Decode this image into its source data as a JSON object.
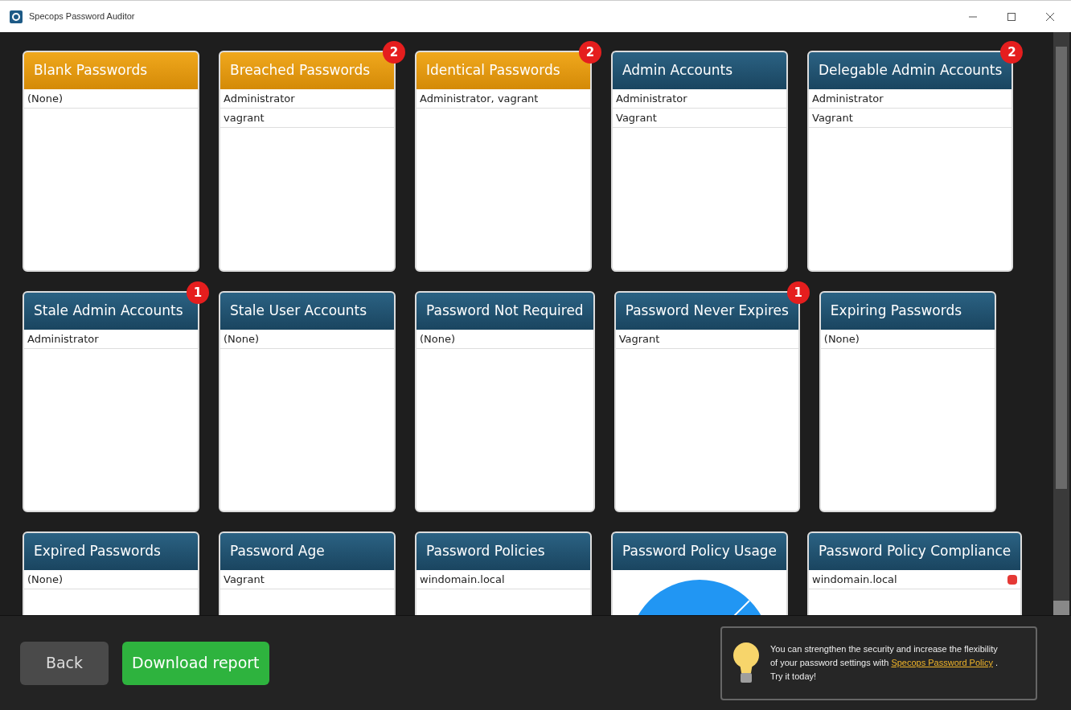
{
  "window": {
    "title": "Specops Password Auditor"
  },
  "rows": [
    [
      {
        "title": "Blank Passwords",
        "kind": "warning",
        "items": [
          {
            "text": "(None)"
          }
        ]
      },
      {
        "title": "Breached Passwords",
        "kind": "warning",
        "badge": "2",
        "items": [
          {
            "text": "Administrator"
          },
          {
            "text": "vagrant"
          }
        ]
      },
      {
        "title": "Identical Passwords",
        "kind": "warning",
        "badge": "2",
        "items": [
          {
            "text": "Administrator, vagrant"
          }
        ]
      },
      {
        "title": "Admin Accounts",
        "kind": "info",
        "items": [
          {
            "text": "Administrator"
          },
          {
            "text": "Vagrant"
          }
        ]
      },
      {
        "title": "Delegable Admin Accounts",
        "kind": "info",
        "badge": "2",
        "items": [
          {
            "text": "Administrator"
          },
          {
            "text": "Vagrant"
          }
        ]
      }
    ],
    [
      {
        "title": "Stale Admin Accounts",
        "kind": "info",
        "badge": "1",
        "items": [
          {
            "text": "Administrator"
          }
        ]
      },
      {
        "title": "Stale User Accounts",
        "kind": "info",
        "items": [
          {
            "text": "(None)"
          }
        ]
      },
      {
        "title": "Password Not Required",
        "kind": "info",
        "items": [
          {
            "text": "(None)"
          }
        ]
      },
      {
        "title": "Password Never Expires",
        "kind": "info",
        "badge": "1",
        "items": [
          {
            "text": "Vagrant"
          }
        ]
      },
      {
        "title": "Expiring Passwords",
        "kind": "info",
        "items": [
          {
            "text": "(None)"
          }
        ]
      }
    ],
    [
      {
        "title": "Expired Passwords",
        "kind": "info",
        "items": [
          {
            "text": "(None)"
          }
        ]
      },
      {
        "title": "Password Age",
        "kind": "info",
        "items": [
          {
            "text": "Vagrant"
          }
        ]
      },
      {
        "title": "Password Policies",
        "kind": "info",
        "items": [
          {
            "text": "windomain.local"
          }
        ]
      },
      {
        "title": "Password Policy Usage",
        "kind": "info"
      },
      {
        "title": "Password Policy Compliance",
        "kind": "info",
        "items": [
          {
            "text": "windomain.local",
            "compliant": false
          }
        ]
      }
    ]
  ],
  "buttons": {
    "back": "Back",
    "download": "Download report"
  },
  "tip": {
    "before": "You can strengthen the security and increase the flexibility of your password settings with ",
    "link": "Specops Password Policy",
    "after": " . Try it today!"
  }
}
